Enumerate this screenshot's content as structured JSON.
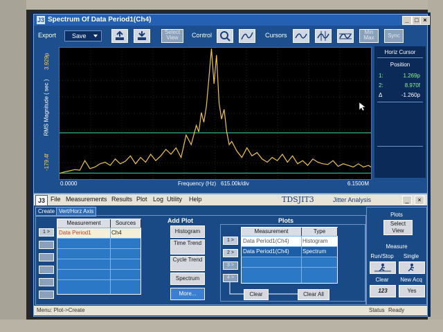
{
  "spectrum_window": {
    "title": "Spectrum Of Data Period1(Ch4)",
    "export_label": "Export",
    "save_label": "Save",
    "select_view_label": "Select View",
    "control_label": "Control",
    "cursors_label": "Cursors",
    "min_max_label": "Min Max",
    "sync_label": "Sync"
  },
  "horiz_cursor": {
    "title": "Horiz Cursor",
    "position_label": "Position",
    "c1_label": "1:",
    "c1_value": "1.269p",
    "c2_label": "2:",
    "c2_value": "8.970f",
    "delta_label": "Δ",
    "delta_value": "-1.260p"
  },
  "chart_data": {
    "type": "line",
    "xlabel": "Frequency (Hz)",
    "x_scale_label": "615.00k/div",
    "x_start_label": "0.0000",
    "x_end_label": "6.1500M",
    "ylabel": "RMS Magnitude ( sec )",
    "y_top_label": "3.929p",
    "y_bottom_label": "-179.4f",
    "xlim": [
      0,
      6.15
    ],
    "ylim": [
      -0.1794,
      3.929
    ],
    "cursor_levels": [
      1.269,
      0.00897
    ],
    "grid": true,
    "series": [
      {
        "color": "#f3c64a",
        "x": [
          0.0,
          0.1,
          0.2,
          0.3,
          0.4,
          0.5,
          0.6,
          0.7,
          0.8,
          0.9,
          1.0,
          1.1,
          1.2,
          1.3,
          1.4,
          1.5,
          1.6,
          1.7,
          1.8,
          1.9,
          2.0,
          2.1,
          2.2,
          2.3,
          2.4,
          2.5,
          2.6,
          2.7,
          2.75,
          2.8,
          2.85,
          2.9,
          2.95,
          3.0,
          3.05,
          3.1,
          3.15,
          3.2,
          3.25,
          3.3,
          3.35,
          3.4,
          3.5,
          3.6,
          3.7,
          3.8,
          3.9,
          4.0,
          4.1,
          4.2,
          4.3,
          4.4,
          4.5,
          4.6,
          4.7,
          4.8,
          4.9,
          5.0,
          5.1,
          5.2,
          5.3,
          5.4,
          5.5,
          5.6,
          5.7,
          5.8,
          5.9,
          6.0,
          6.1,
          6.15
        ],
        "y": [
          0.0,
          0.05,
          0.08,
          0.12,
          0.1,
          0.4,
          0.15,
          0.2,
          0.3,
          0.35,
          0.25,
          0.45,
          0.3,
          0.38,
          0.55,
          0.3,
          0.5,
          0.35,
          0.6,
          0.4,
          0.55,
          0.75,
          0.6,
          0.8,
          0.5,
          1.2,
          0.9,
          1.5,
          1.3,
          1.9,
          1.6,
          2.1,
          3.0,
          3.9,
          2.8,
          3.7,
          2.2,
          1.7,
          2.0,
          1.3,
          0.9,
          1.0,
          0.7,
          0.5,
          0.8,
          0.55,
          0.65,
          0.45,
          0.35,
          0.5,
          0.4,
          0.6,
          0.35,
          0.55,
          0.3,
          0.4,
          0.25,
          0.45,
          0.35,
          0.3,
          0.28,
          0.4,
          0.22,
          0.3,
          0.25,
          0.2,
          0.3,
          0.2,
          0.25,
          0.2
        ]
      }
    ]
  },
  "jit_window": {
    "logo": "J3",
    "menu": [
      "File",
      "Measurements",
      "Results",
      "Plot",
      "Log",
      "Utility",
      "Help"
    ],
    "brand": "TDSJIT3",
    "brand_sub": "Jitter Analysis",
    "tabs": [
      "Create",
      "Vert/Horz Axis"
    ],
    "meas_table": {
      "headers": [
        "Measurement",
        "Sources"
      ],
      "rows": [
        [
          "Data Period1",
          "Ch4"
        ]
      ]
    },
    "row_button_1": "1 >",
    "add_plot_title": "Add Plot",
    "add_plot_buttons": [
      "Histogram",
      "Time Trend",
      "Cycle Trend",
      "Spectrum",
      "More..."
    ],
    "plots_title": "Plots",
    "plots_table": {
      "headers": [
        "Measurement",
        "Type"
      ],
      "rows": [
        [
          "Data Period1(Ch4)",
          "Histogram"
        ],
        [
          "Data Period1(Ch4)",
          "Spectrum"
        ]
      ]
    },
    "plot_row_buttons": [
      "1 >",
      "2 >",
      "3 >",
      "4 >"
    ],
    "clear_label": "Clear",
    "clear_all_label": "Clear All",
    "right_panel": {
      "plots_label": "Plots",
      "select_view_label": "Select View",
      "measure_label": "Measure",
      "run_stop_label": "Run/Stop",
      "single_label": "Single",
      "clear_label": "Clear",
      "new_acq_label": "New Acq",
      "yes_label": "Yes",
      "clear_icon_text": "123"
    },
    "status_left": "Menu: Plot->Create",
    "status_right_label": "Status",
    "status_right_value": "Ready"
  }
}
